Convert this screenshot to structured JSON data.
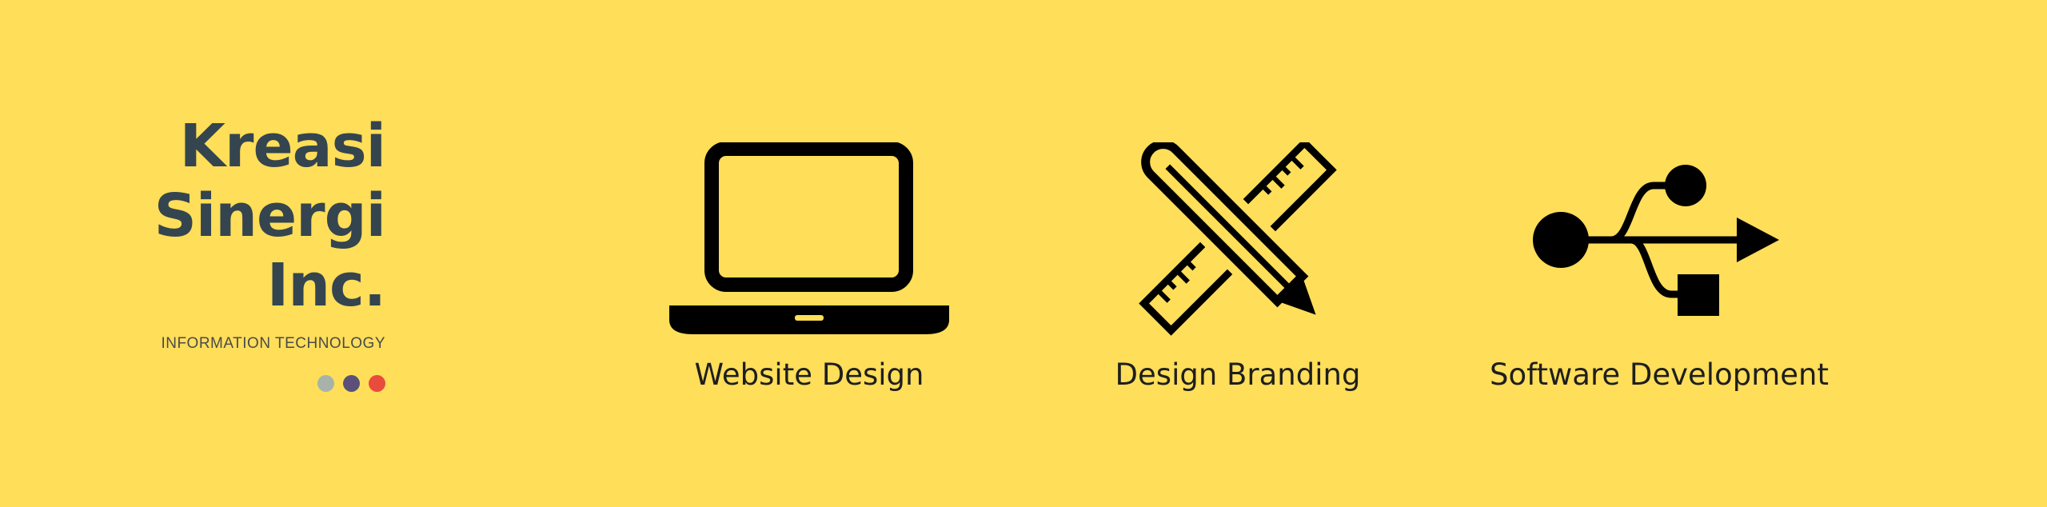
{
  "brand": {
    "name_lines": [
      "Kreasi",
      "Sinergi",
      "Inc."
    ],
    "tagline": "INFORMATION TECHNOLOGY",
    "dot_colors": [
      "#A7B3AA",
      "#5B5078",
      "#E94B3C"
    ]
  },
  "services": [
    {
      "label": "Website Design",
      "icon": "laptop-icon"
    },
    {
      "label": "Design Branding",
      "icon": "ruler-pencil-icon"
    },
    {
      "label": "Software Development",
      "icon": "usb-icon"
    }
  ],
  "colors": {
    "background": "#FFDE59",
    "brand_text": "#34454F",
    "icon": "#000000"
  }
}
